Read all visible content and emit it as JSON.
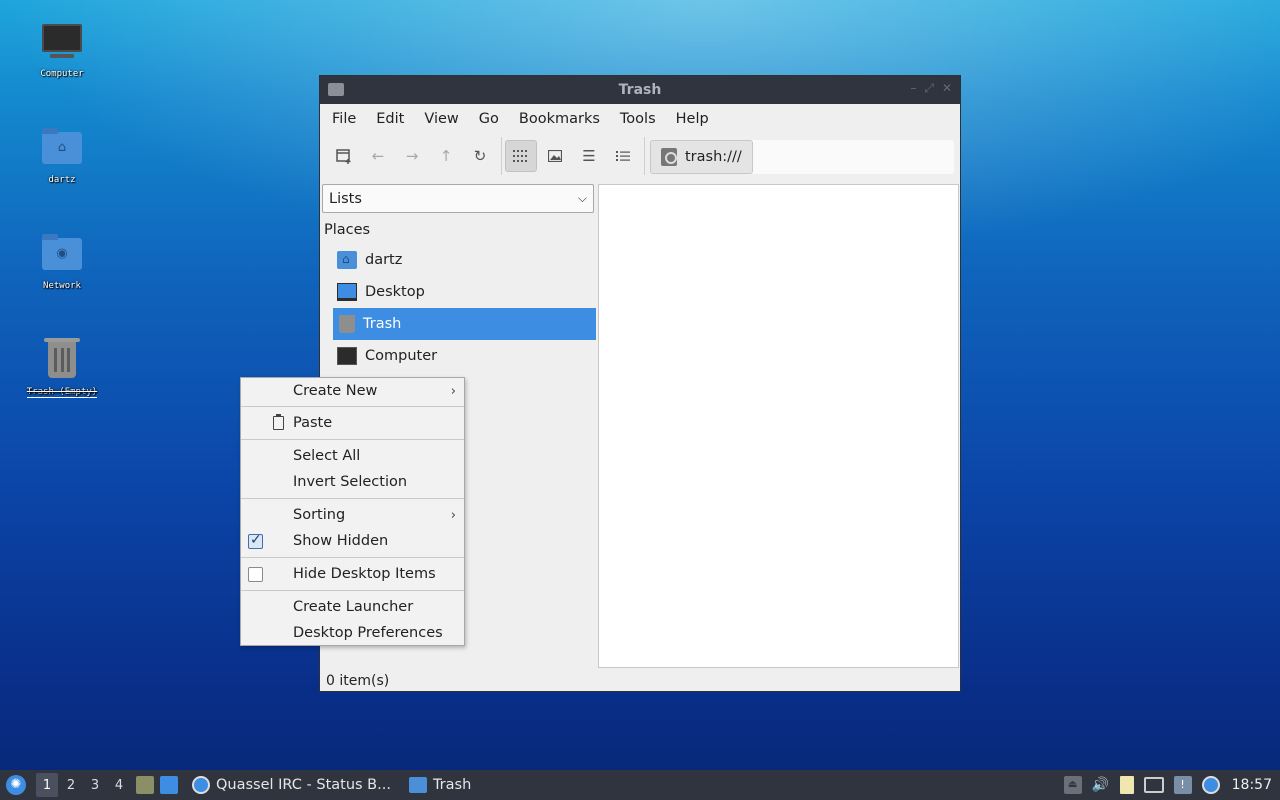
{
  "desktop": {
    "icons": [
      {
        "label": "Computer",
        "icon": "computer-icon"
      },
      {
        "label": "dartz",
        "icon": "home-folder-icon"
      },
      {
        "label": "Network",
        "icon": "network-folder-icon"
      },
      {
        "label": "Trash (Empty)",
        "icon": "trash-icon"
      }
    ]
  },
  "window": {
    "title": "Trash",
    "menu": [
      "File",
      "Edit",
      "View",
      "Go",
      "Bookmarks",
      "Tools",
      "Help"
    ],
    "toolbar": {
      "new_tab": "new-tab-icon",
      "back": "arrow-left-icon",
      "forward": "arrow-right-icon",
      "up": "arrow-up-icon",
      "reload": "reload-icon",
      "view_icons": "grid-view-icon",
      "view_thumbnails": "thumbnail-view-icon",
      "view_compact": "compact-view-icon",
      "view_detailed": "detailed-list-icon"
    },
    "path": "trash:///",
    "side_pane": {
      "mode": "Lists",
      "places_header": "Places",
      "places": [
        {
          "label": "dartz",
          "icon": "home-folder-icon"
        },
        {
          "label": "Desktop",
          "icon": "desktop-icon"
        },
        {
          "label": "Trash",
          "icon": "trash-icon",
          "selected": true
        },
        {
          "label": "Computer",
          "icon": "computer-icon"
        }
      ]
    },
    "status": "0 item(s)"
  },
  "context_menu": {
    "create_new": "Create New",
    "paste": "Paste",
    "select_all": "Select All",
    "invert_selection": "Invert Selection",
    "sorting": "Sorting",
    "show_hidden": "Show Hidden",
    "show_hidden_checked": true,
    "hide_desktop_items": "Hide Desktop Items",
    "hide_desktop_items_checked": false,
    "create_launcher": "Create Launcher",
    "desktop_preferences": "Desktop Preferences"
  },
  "taskbar": {
    "workspaces": [
      "1",
      "2",
      "3",
      "4"
    ],
    "tasks": [
      {
        "label": "Quassel IRC - Status B...",
        "icon": "quassel-icon"
      },
      {
        "label": "Trash",
        "icon": "folder-icon"
      }
    ],
    "clock": "18:57"
  },
  "colors": {
    "accent": "#3d8ee2",
    "titlebar": "#2f343f",
    "taskbar": "#2f343f"
  }
}
